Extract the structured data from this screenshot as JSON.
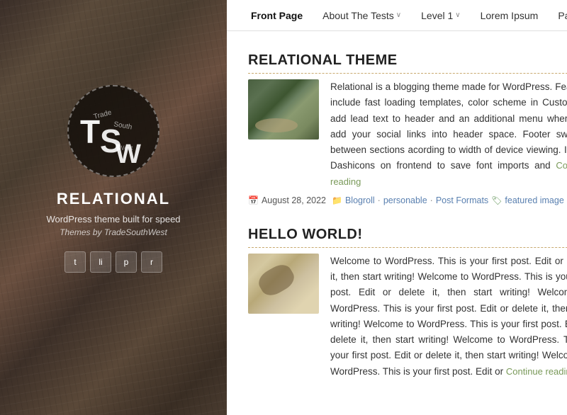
{
  "sidebar": {
    "logo_letters": "TSW",
    "site_title": "RELATIONAL",
    "site_tagline": "WordPress theme built for speed",
    "site_credit": "Themes by TradeSouthWest",
    "social_links": [
      {
        "label": "t",
        "name": "twitter"
      },
      {
        "label": "li",
        "name": "linkedin"
      },
      {
        "label": "p",
        "name": "pinterest"
      },
      {
        "label": "r",
        "name": "rss"
      }
    ]
  },
  "nav": {
    "items": [
      {
        "label": "Front Page",
        "active": true,
        "has_chevron": false
      },
      {
        "label": "About The Tests",
        "active": false,
        "has_chevron": true
      },
      {
        "label": "Level 1",
        "active": false,
        "has_chevron": true
      },
      {
        "label": "Lorem Ipsum",
        "active": false,
        "has_chevron": false
      },
      {
        "label": "Page A",
        "active": false,
        "has_chevron": false
      }
    ]
  },
  "posts": [
    {
      "title": "RELATIONAL THEME",
      "text": "Relational is a blogging theme made for WordPress. Features include fast loading templates, color scheme in Customizer, add lead text to header and an additional menu where you add your social links into header space. Footer switches between sections acording to width of device viewing. It uses Dashicons on frontend to save font imports and",
      "continue_reading": "Continue reading",
      "date": "August 28, 2022",
      "categories": [
        "Blogroll",
        "personable"
      ],
      "formats": "Post Formats",
      "tag_label": "featured image"
    },
    {
      "title": "HELLO WORLD!",
      "text": "Welcome to WordPress. This is your first post. Edit or delete it, then start writing! Welcome to WordPress. This is your first post. Edit or delete it, then start writing! Welcome to WordPress. This is your first post. Edit or delete it, then start writing! Welcome to WordPress. This is your first post. Edit or delete it, then start writing! Welcome to WordPress. This is your first post. Edit or delete it, then start writing! Welcome to WordPress. This is your first post. Edit or",
      "continue_reading": "Continue reading"
    }
  ],
  "icons": {
    "calendar": "📅",
    "folder": "📁",
    "tag": "🏷"
  }
}
